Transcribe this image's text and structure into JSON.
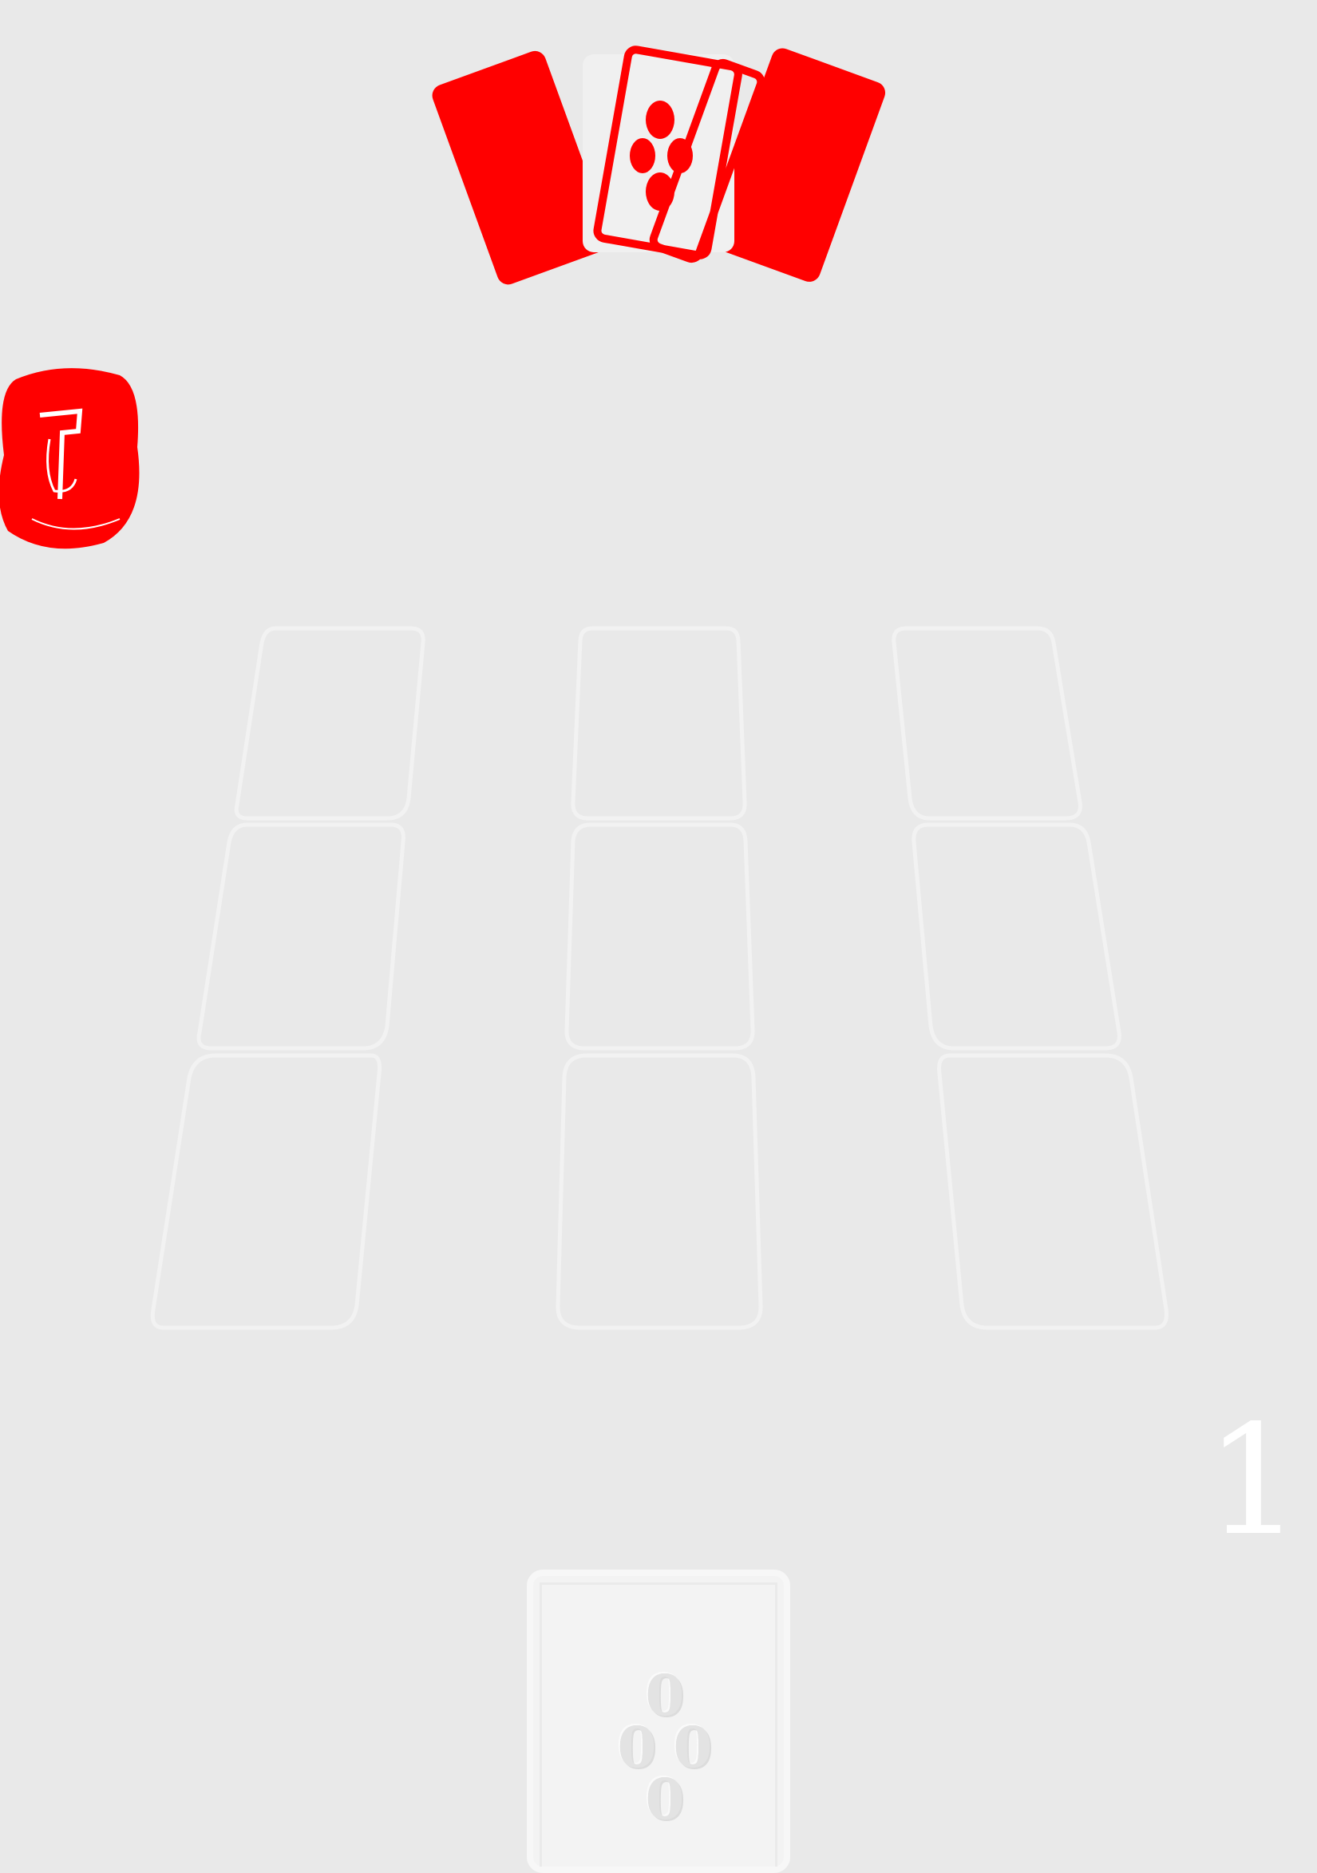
{
  "opponent": {
    "hand_icon": "fanned-cards-icon",
    "badge_icon": "opponent-token-icon",
    "badge_value": "1"
  },
  "board": {
    "columns": 3,
    "rows": 3,
    "slot_state": "empty"
  },
  "player": {
    "score": "1",
    "card_value": "0",
    "card_pips": [
      "0",
      "0",
      "0",
      "0"
    ]
  },
  "colors": {
    "background": "#e9e9e9",
    "opponent_accent": "#ff0000",
    "slot_outline": "#f2f2f2",
    "score_text": "#ffffff"
  }
}
